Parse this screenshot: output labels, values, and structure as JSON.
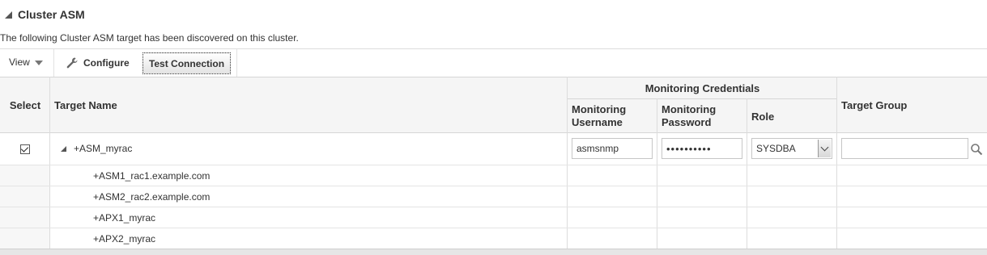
{
  "section": {
    "title": "Cluster ASM",
    "description": "The following Cluster ASM target has been discovered on this cluster."
  },
  "toolbar": {
    "view_label": "View",
    "configure_label": "Configure",
    "test_connection_label": "Test Connection"
  },
  "table": {
    "headers": {
      "select": "Select",
      "target_name": "Target Name",
      "monitoring_credentials": "Monitoring Credentials",
      "monitoring_username": "Monitoring Username",
      "monitoring_password": "Monitoring Password",
      "role": "Role",
      "target_group": "Target Group"
    },
    "parent_row": {
      "target_name": "+ASM_myrac",
      "username": "asmsnmp",
      "password_mask": "••••••••••",
      "role": "SYSDBA",
      "target_group": "",
      "selected": true
    },
    "child_rows": [
      {
        "target_name": "+ASM1_rac1.example.com"
      },
      {
        "target_name": "+ASM2_rac2.example.com"
      },
      {
        "target_name": "+APX1_myrac"
      },
      {
        "target_name": "+APX2_myrac"
      }
    ]
  },
  "icons": {
    "collapse": "collapse-triangle-icon",
    "view_dropdown": "chevron-down-icon",
    "configure": "wrench-icon",
    "search": "search-icon",
    "checkbox": "checkbox-checked-icon",
    "select_dropdown": "chevron-down-icon"
  }
}
